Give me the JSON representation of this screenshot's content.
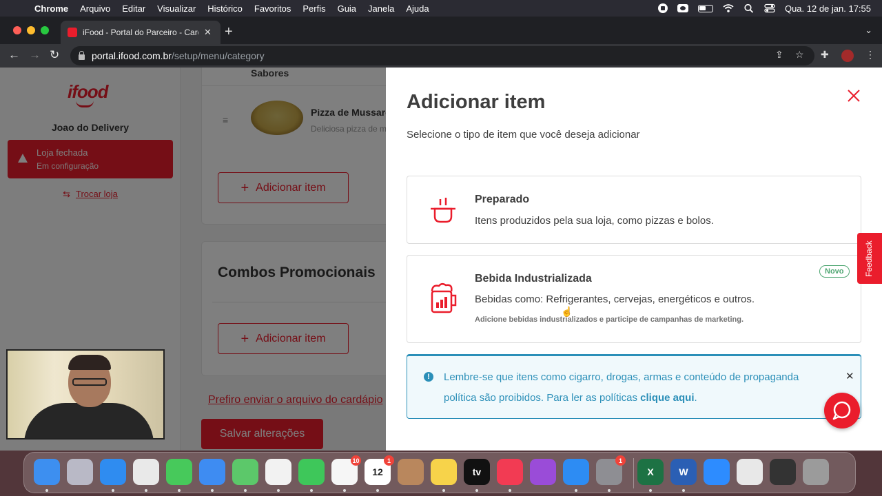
{
  "menubar": {
    "apple_glyph": "",
    "items": [
      "Chrome",
      "Arquivo",
      "Editar",
      "Visualizar",
      "Histórico",
      "Favoritos",
      "Perfis",
      "Guia",
      "Janela",
      "Ajuda"
    ],
    "clock": "Qua. 12 de jan.  17:55"
  },
  "browser": {
    "tab_title": "iFood - Portal do Parceiro - Cardápio",
    "url_host": "portal.ifood.com.br",
    "url_path": "/setup/menu/category"
  },
  "sidebar": {
    "logo": "ifood",
    "store_name": "Joao do Delivery",
    "status_title": "Loja fechada",
    "status_sub": "Em configuração",
    "switch_label": "Trocar loja"
  },
  "menu_editor": {
    "column_header": "Sabores",
    "item_name": "Pizza de Mussarela",
    "item_desc": "Deliciosa pizza de mussarela",
    "add_item_label": "Adicionar item",
    "category2": "Combos Promocionais",
    "upload_link": "Prefiro enviar o arquivo do cardápio",
    "save_label": "Salvar alterações"
  },
  "drawer": {
    "title": "Adicionar item",
    "subtitle": "Selecione o tipo de item que você deseja adicionar",
    "options": [
      {
        "title": "Preparado",
        "desc": "Itens produzidos pela sua loja, como pizzas e bolos.",
        "icon": "pot-icon"
      },
      {
        "title": "Bebida Industrializada",
        "desc": "Bebidas como: Refrigerantes, cervejas, energéticos e outros.",
        "note": "Adicione bebidas industrializados e participe de campanhas de marketing.",
        "badge": "Novo",
        "icon": "beer-mug-icon"
      }
    ],
    "alert": {
      "text_main": "Lembre-se que itens como cigarro, drogas, armas e conteúdo de propaganda política são proibidos. Para ler as políticas ",
      "link": "clique aqui",
      "text_end": "."
    }
  },
  "feedback_label": "Feedback",
  "dock": {
    "apps": [
      {
        "name": "Finder",
        "color": "#3d8ff0"
      },
      {
        "name": "Launchpad",
        "color": "#b9b9c6"
      },
      {
        "name": "Safari",
        "color": "#2f8cf0"
      },
      {
        "name": "Chrome",
        "color": "#e9e9e9"
      },
      {
        "name": "Mensagens",
        "color": "#47c95b"
      },
      {
        "name": "Mail",
        "color": "#3e8cf2"
      },
      {
        "name": "Mapas",
        "color": "#5cc86a"
      },
      {
        "name": "Fotos",
        "color": "#f2f2f2"
      },
      {
        "name": "FaceTime",
        "color": "#3ec75a"
      },
      {
        "name": "Lembretes",
        "color": "#f6f6f6",
        "badge": "10"
      },
      {
        "name": "Calendário",
        "color": "#ffffff",
        "badge": "1",
        "text": "12"
      },
      {
        "name": "Contatos",
        "color": "#b9875d"
      },
      {
        "name": "Notas",
        "color": "#f7d34a"
      },
      {
        "name": "TV",
        "color": "#111111",
        "text": "tv"
      },
      {
        "name": "Música",
        "color": "#f23b53"
      },
      {
        "name": "Podcasts",
        "color": "#9a4cd8"
      },
      {
        "name": "App Store",
        "color": "#2d8cf3"
      },
      {
        "name": "Ajustes",
        "color": "#8e8e93",
        "badge": "1"
      },
      {
        "name": "Excel",
        "color": "#1d7244",
        "text": "X"
      },
      {
        "name": "Word",
        "color": "#2b5fb4",
        "text": "W"
      },
      {
        "name": "Zoom",
        "color": "#2d8cff"
      },
      {
        "name": "Documentos",
        "color": "#e8e8e8"
      },
      {
        "name": "Monitor",
        "color": "#333333"
      },
      {
        "name": "Lixo",
        "color": "#9b9b9b"
      }
    ]
  }
}
